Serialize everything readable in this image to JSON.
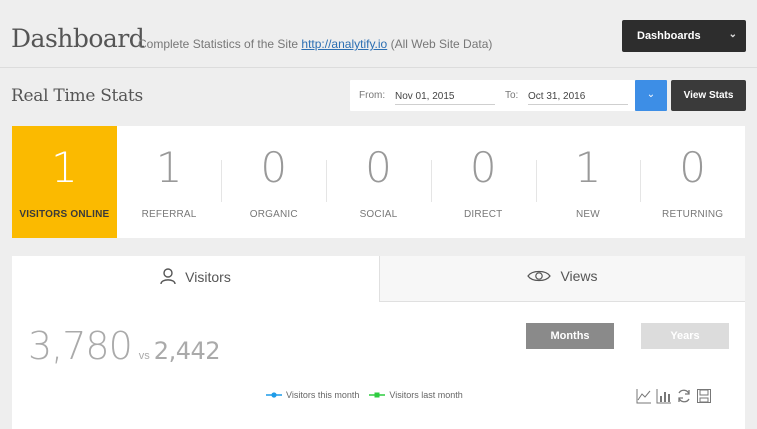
{
  "header": {
    "title": "Dashboard",
    "subtitle_prefix": "Complete Statistics of the Site ",
    "subtitle_link": "http://analytify.io",
    "subtitle_suffix": " (All Web Site Data)",
    "dashboards_label": "Dashboards"
  },
  "realtime": {
    "title": "Real Time Stats",
    "from_label": "From:",
    "from_value": "Nov 01, 2015",
    "to_label": "To:",
    "to_value": "Oct 31, 2016",
    "view_stats_label": "View Stats"
  },
  "stats": [
    {
      "value": "1",
      "label": "VISITORS ONLINE"
    },
    {
      "value": "1",
      "label": "REFERRAL"
    },
    {
      "value": "0",
      "label": "ORGANIC"
    },
    {
      "value": "0",
      "label": "SOCIAL"
    },
    {
      "value": "0",
      "label": "DIRECT"
    },
    {
      "value": "1",
      "label": "NEW"
    },
    {
      "value": "0",
      "label": "RETURNING"
    }
  ],
  "panel": {
    "tab_visitors": "Visitors",
    "tab_views": "Views",
    "current_total": "3,780",
    "vs_label": "vs",
    "previous_total": "2,442",
    "months_label": "Months",
    "years_label": "Years",
    "legend_this_month": "Visitors this month",
    "legend_last_month": "Visitors last month"
  },
  "colors": {
    "accent_yellow": "#fbba00",
    "primary_blue": "#3d8ee6",
    "dark_button": "#3a3a3a",
    "series_this_month": "#1e9be8",
    "series_last_month": "#2ecc40"
  }
}
